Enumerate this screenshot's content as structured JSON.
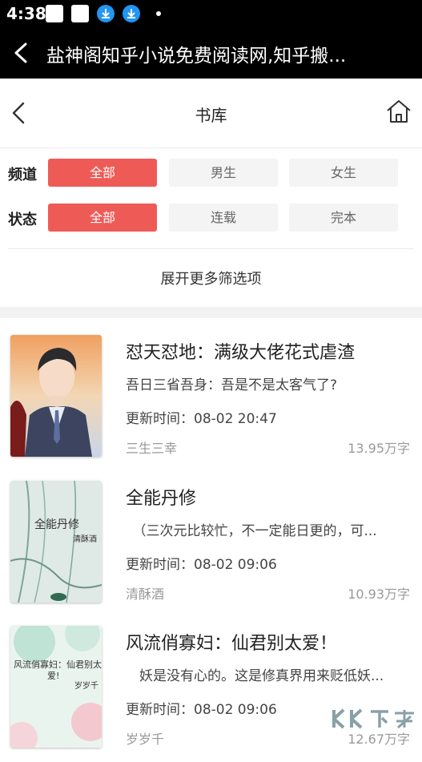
{
  "status_bar": {
    "time": "4:38"
  },
  "title_bar": {
    "title": "盐神阁知乎小说免费阅读网,知乎搬..."
  },
  "library": {
    "title": "书库"
  },
  "filters": {
    "channel": {
      "label": "频道",
      "options": [
        "全部",
        "男生",
        "女生"
      ],
      "selected": "全部"
    },
    "status": {
      "label": "状态",
      "options": [
        "全部",
        "连载",
        "完本"
      ],
      "selected": "全部"
    },
    "more_label": "展开更多筛选项"
  },
  "books": [
    {
      "title": "怼天怼地：满级大佬花式虐渣",
      "desc": "吾日三省吾身：吾是不是太客气了?",
      "updated": "更新时间：08-02 20:47",
      "author": "三生三幸",
      "words": "13.95万字"
    },
    {
      "title": "全能丹修",
      "desc": "　（三次元比较忙，不一定能日更的，可...",
      "updated": "更新时间：08-02 09:06",
      "author": "清酥酒",
      "words": "10.93万字",
      "cover_title": "全能丹修",
      "cover_author": "清酥酒"
    },
    {
      "title": "风流俏寡妇：仙君别太爱！",
      "desc": "　妖是没有心的。这是修真界用来贬低妖...",
      "updated": "更新时间：08-02 09:06",
      "author": "岁岁千",
      "words": "12.67万字",
      "cover_title_1": "风流俏寡妇：仙君别太",
      "cover_title_2": "爱!",
      "cover_author": "岁岁千"
    }
  ]
}
